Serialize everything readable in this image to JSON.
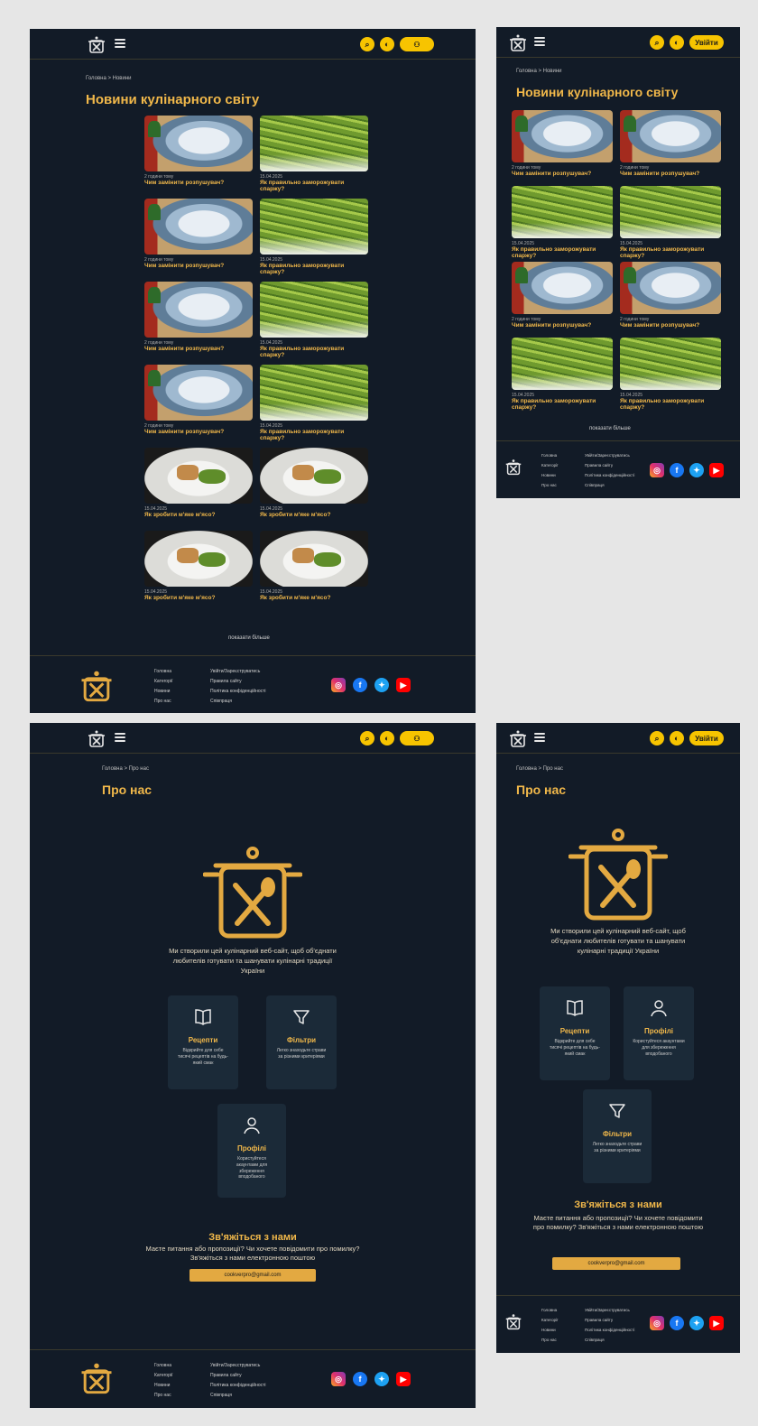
{
  "colors": {
    "bg": "#121b27",
    "accent": "#f1b84a",
    "yellow": "#f7c400",
    "card": "#1b2a38",
    "page": "#e6e6e6"
  },
  "header": {
    "login_label": "Увійти",
    "icons": [
      "pot-logo-icon",
      "menu-icon",
      "search-icon",
      "theme-toggle-icon",
      "user-icon"
    ]
  },
  "news": {
    "breadcrumb": "Головна > Новини",
    "title": "Новини кулінарного світу",
    "show_more": "показати більше",
    "cards": [
      {
        "meta": "2 години тому",
        "title": "Чим замінити розпушувач?"
      },
      {
        "meta": "15.04.2025",
        "title": "Як правильно заморожувати спаржу?"
      },
      {
        "meta": "2 години тому",
        "title": "Чим замінити розпушувач?"
      },
      {
        "meta": "15.04.2025",
        "title": "Як правильно заморожувати спаржу?"
      },
      {
        "meta": "2 години тому",
        "title": "Чим замінити розпушувач?"
      },
      {
        "meta": "15.04.2025",
        "title": "Як правильно заморожувати спаржу?"
      },
      {
        "meta": "2 години тому",
        "title": "Чим замінити розпушувач?"
      },
      {
        "meta": "15.04.2025",
        "title": "Як правильно заморожувати спаржу?"
      },
      {
        "meta": "15.04.2025",
        "title": "Як зробити м'яке м'ясо?"
      },
      {
        "meta": "15.04.2025",
        "title": "Як зробити м'яке м'ясо?"
      },
      {
        "meta": "15.04.2025",
        "title": "Як зробити м'яке м'ясо?"
      },
      {
        "meta": "15.04.2025",
        "title": "Як зробити м'яке м'ясо?"
      }
    ]
  },
  "about": {
    "breadcrumb": "Головна > Про нас",
    "title": "Про нас",
    "intro": "Ми створили цей кулінарний веб-сайт, щоб об'єднати любителів готувати та шанувати кулінарні традиції України",
    "features": [
      {
        "icon": "book-icon",
        "name": "Рецепти",
        "desc": "Відкрийте для себе тисячі рецептів на будь-який смак"
      },
      {
        "icon": "filter-icon",
        "name": "Фільтри",
        "desc": "Легко знаходьте страви за різними критеріями"
      },
      {
        "icon": "user-icon",
        "name": "Профілі",
        "desc": "Користуйтеся акаунтами для збереження вподобаного"
      }
    ],
    "contact_title": "Зв'яжіться з нами",
    "contact_text": "Маєте питання або пропозиції? Чи хочете повідомити про помилку? Зв'яжіться з нами електронною поштою",
    "email": "cookverpro@gmail.com"
  },
  "footer": {
    "col1": [
      "Головна",
      "Категорії",
      "Новини",
      "Про нас"
    ],
    "col2": [
      "Увійти/Зареєструватись",
      "Правила сайту",
      "Політика конфіденційності",
      "Співпраця"
    ],
    "social": [
      "instagram-icon",
      "facebook-icon",
      "twitter-icon",
      "youtube-icon"
    ]
  }
}
